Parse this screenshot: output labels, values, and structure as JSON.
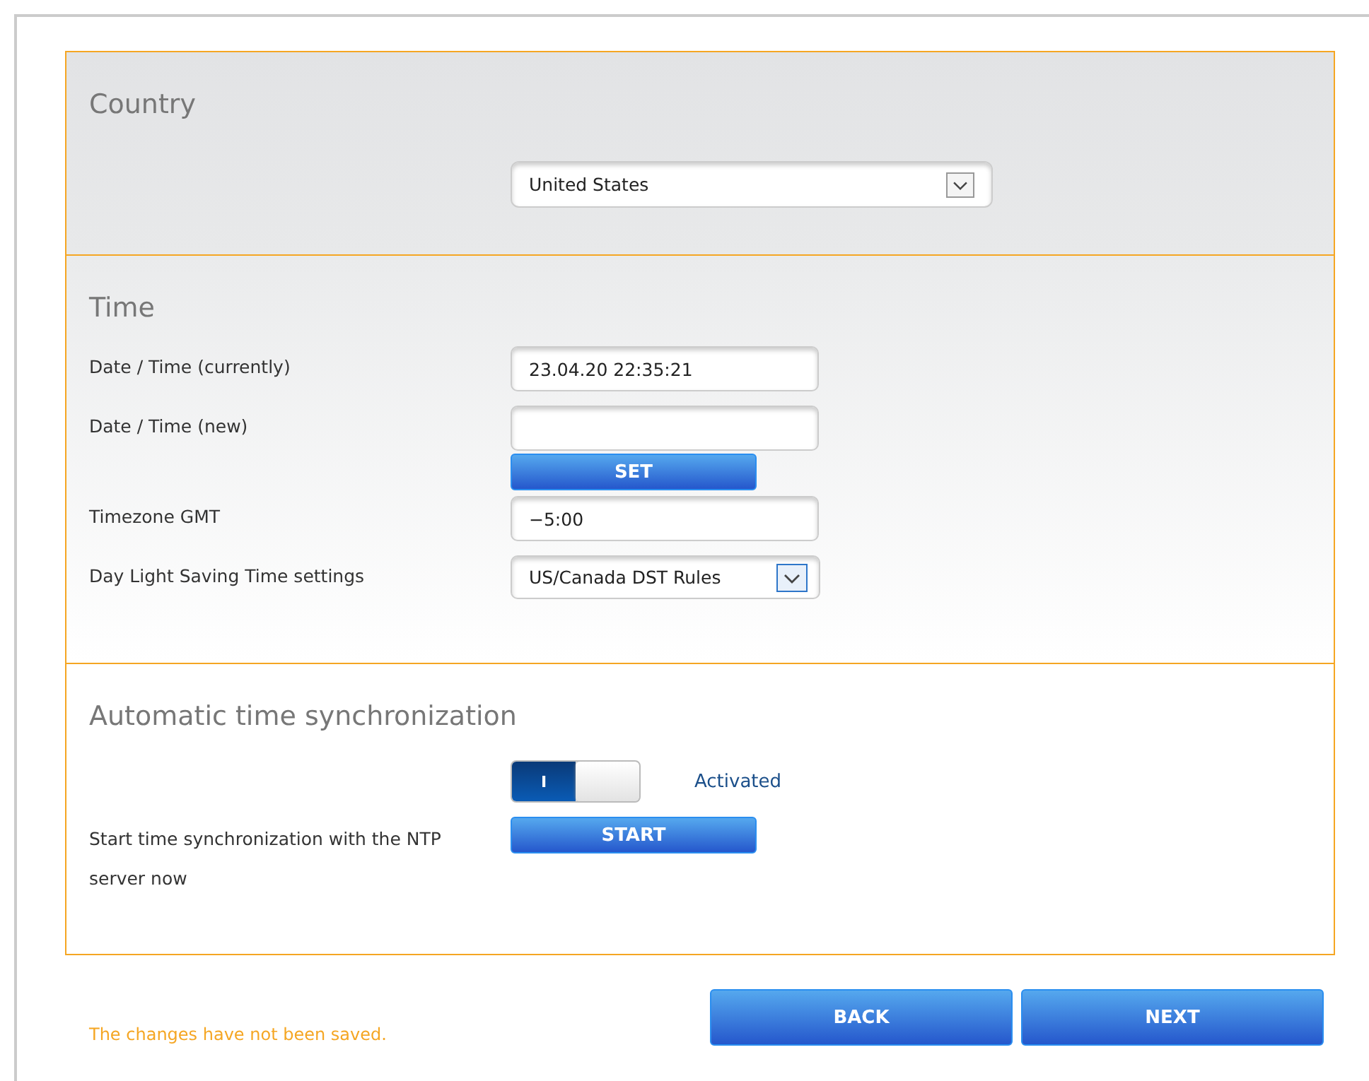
{
  "country": {
    "title": "Country",
    "select": {
      "value": "United States"
    }
  },
  "time": {
    "title": "Time",
    "rows": [
      {
        "kind": "input",
        "label": "Date / Time (currently)",
        "value": "23.04.20 22:35:21"
      },
      {
        "kind": "input",
        "label": "Date / Time (new)"
      },
      {
        "kind": "button",
        "text": "SET"
      },
      {
        "kind": "input",
        "label": "Timezone GMT",
        "value": "−5:00"
      },
      {
        "kind": "select",
        "label": "Day Light Saving Time settings",
        "value": "US/Canada DST Rules"
      }
    ]
  },
  "sync": {
    "title": "Automatic time synchronization",
    "toggle": {
      "on": true,
      "symbol": "I",
      "status": "Activated"
    },
    "label": "Start time synchronization with the NTP server now",
    "button": "START"
  },
  "footer": {
    "message": "The changes have not been saved.",
    "buttons": [
      "BACK",
      "NEXT"
    ]
  }
}
